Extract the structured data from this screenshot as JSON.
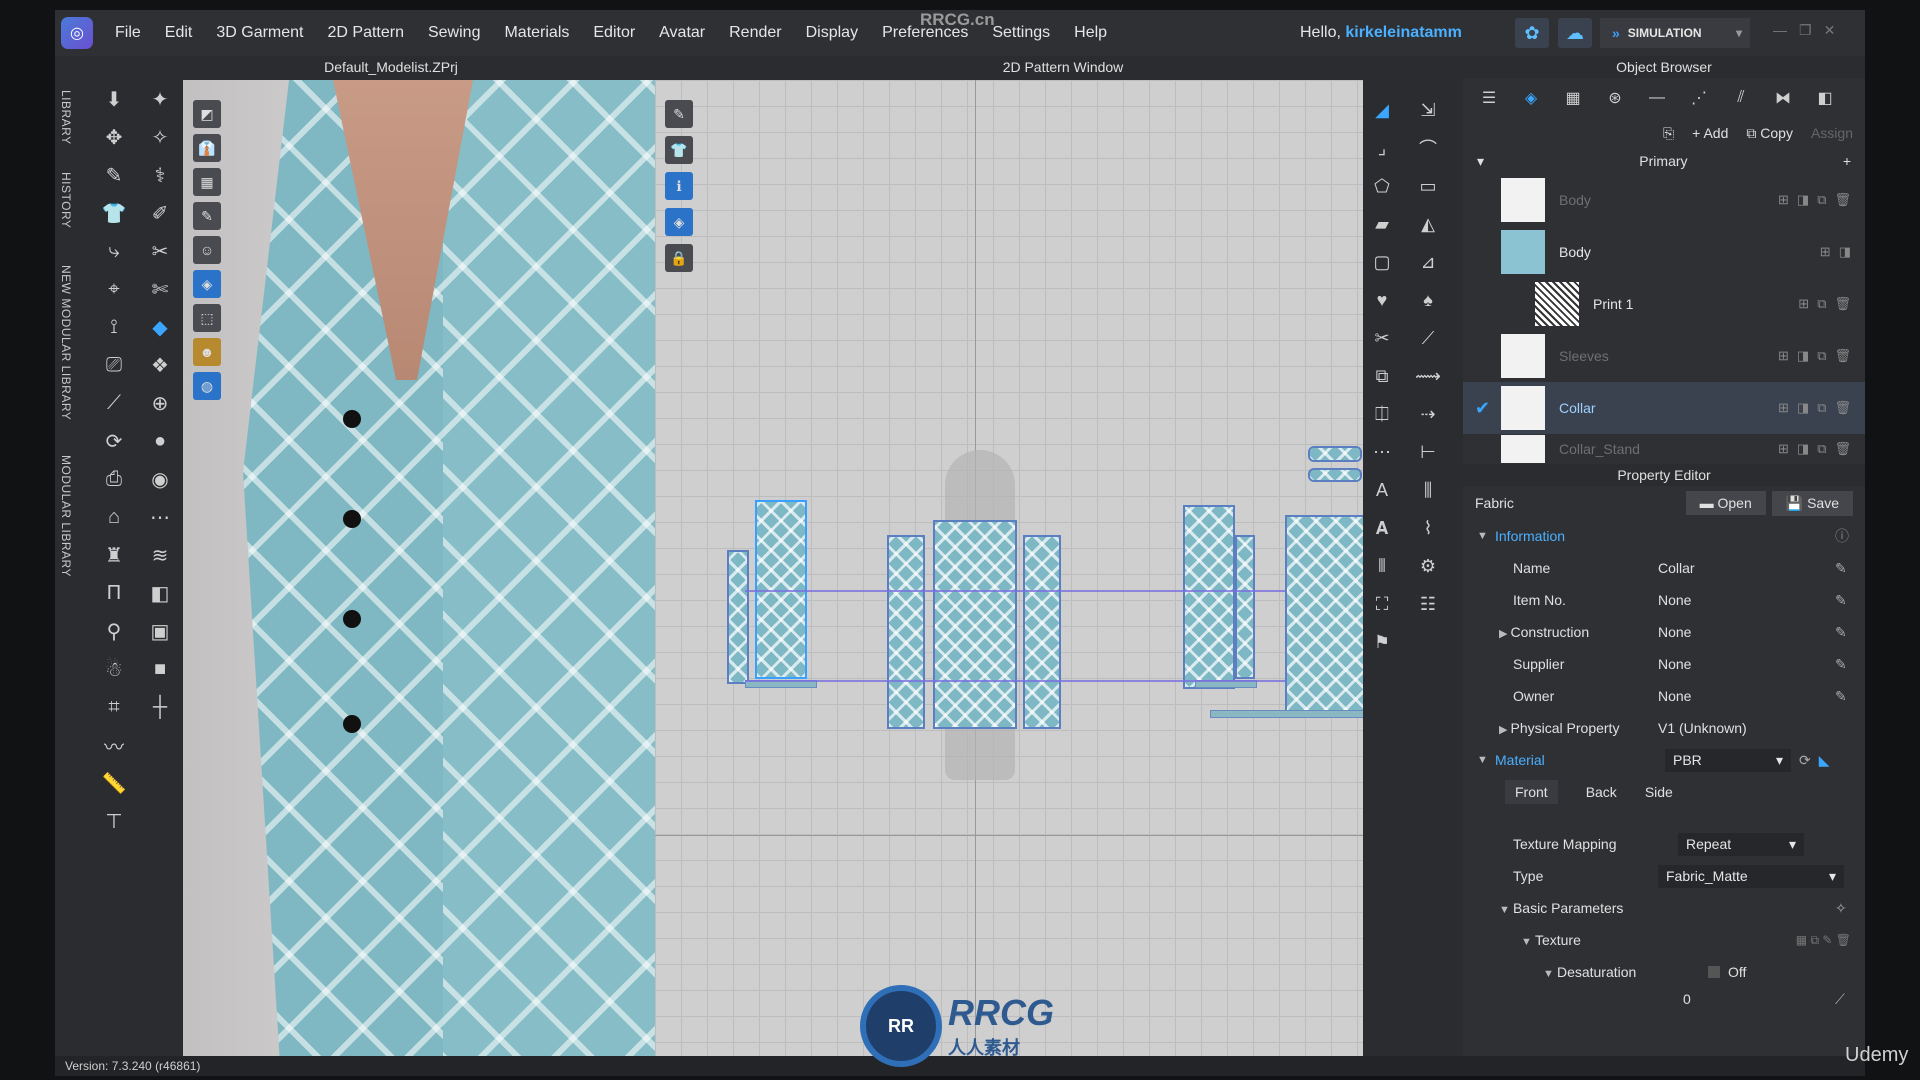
{
  "menubar": {
    "items": [
      "File",
      "Edit",
      "3D Garment",
      "2D Pattern",
      "Sewing",
      "Materials",
      "Editor",
      "Avatar",
      "Render",
      "Display",
      "Preferences",
      "Settings",
      "Help"
    ],
    "greeting_prefix": "Hello,",
    "username": "kirkeleinatamm",
    "mode": "SIMULATION",
    "watermark": "RRCG.cn"
  },
  "left_tabs": [
    "LIBRARY",
    "HISTORY",
    "NEW MODULAR LIBRARY",
    "MODULAR LIBRARY"
  ],
  "panel3d": {
    "title": "Default_Modelist.ZPrj"
  },
  "panel2d": {
    "title": "2D Pattern Window"
  },
  "object_browser": {
    "title": "Object Browser",
    "add_label": "Add",
    "copy_label": "Copy",
    "assign_label": "Assign",
    "group": "Primary",
    "fabrics": [
      {
        "name": "Body",
        "swatch": "white",
        "dim": true
      },
      {
        "name": "Body",
        "swatch": "blue",
        "dim": false
      },
      {
        "name": "Print 1",
        "swatch": "print",
        "dim": false
      },
      {
        "name": "Sleeves",
        "swatch": "white",
        "dim": true
      },
      {
        "name": "Collar",
        "swatch": "white",
        "dim": false,
        "selected": true
      },
      {
        "name": "Collar_Stand",
        "swatch": "white",
        "dim": true
      }
    ]
  },
  "property_editor": {
    "title": "Property Editor",
    "kind": "Fabric",
    "open_label": "Open",
    "save_label": "Save",
    "information_label": "Information",
    "rows": [
      {
        "k": "Name",
        "v": "Collar"
      },
      {
        "k": "Item No.",
        "v": "None"
      },
      {
        "k": "Construction",
        "v": "None",
        "expand": true
      },
      {
        "k": "Supplier",
        "v": "None"
      },
      {
        "k": "Owner",
        "v": "None"
      },
      {
        "k": "Physical Property",
        "v": "V1 (Unknown)",
        "expand": true
      }
    ],
    "material_label": "Material",
    "material_value": "PBR",
    "tabs": [
      "Front",
      "Back",
      "Side"
    ],
    "texture_mapping_label": "Texture Mapping",
    "texture_mapping_value": "Repeat",
    "type_label": "Type",
    "type_value": "Fabric_Matte",
    "basic_params_label": "Basic Parameters",
    "texture_label": "Texture",
    "desaturation_label": "Desaturation",
    "desaturation_value": "Off",
    "desaturation_number": "0"
  },
  "status": {
    "version": "Version: 7.3.240 (r46861)"
  },
  "branding": {
    "rrcg": "RRCG",
    "rrcg_sub": "人人素材",
    "udemy": "Udemy"
  }
}
